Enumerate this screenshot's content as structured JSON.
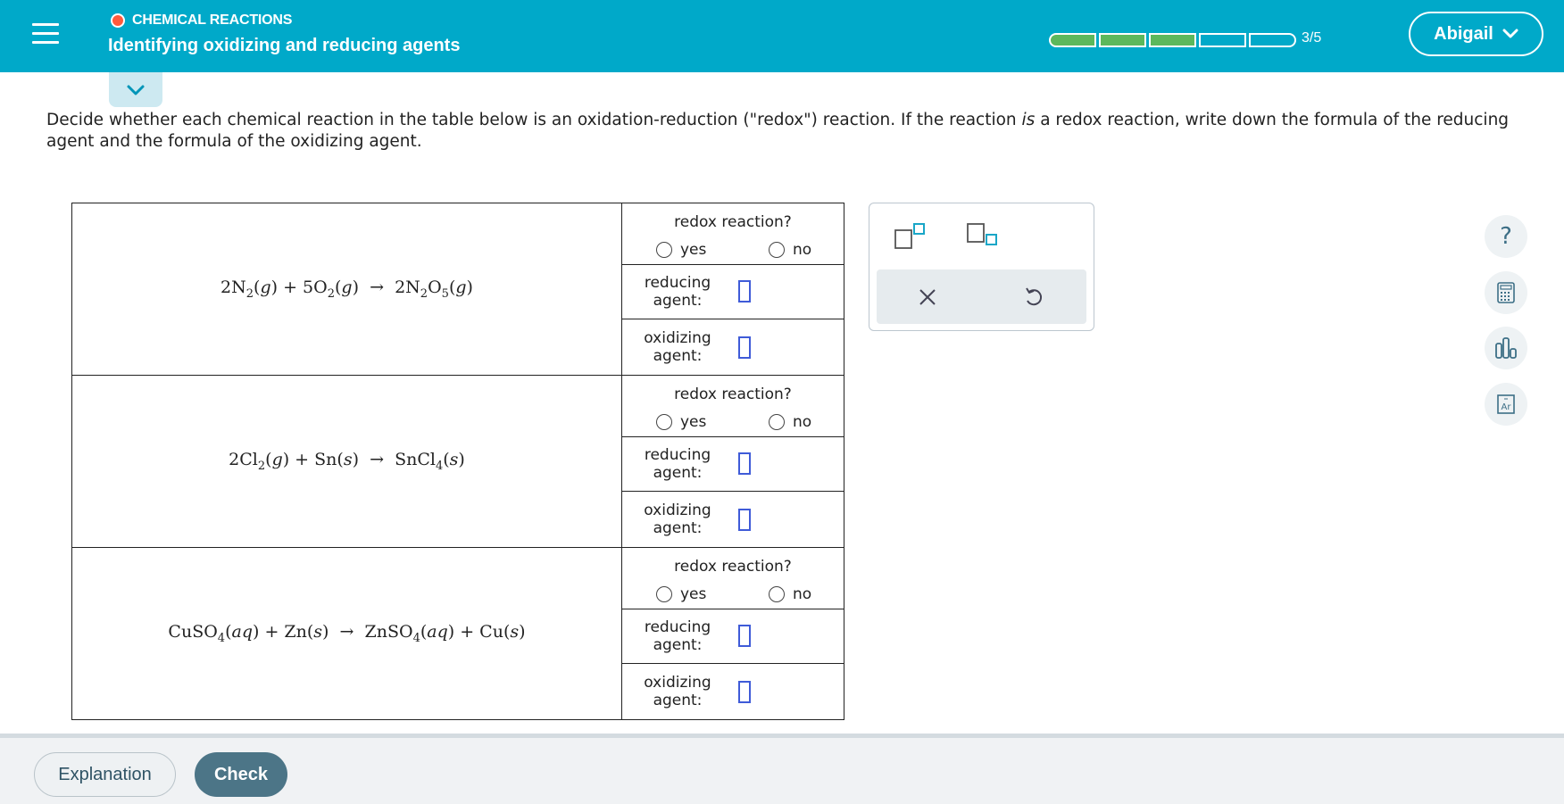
{
  "header": {
    "topic": "CHEMICAL REACTIONS",
    "title": "Identifying oxidizing and reducing agents",
    "progress_text": "3/5",
    "progress": {
      "completed": 3,
      "total": 5
    },
    "user_name": "Abigail"
  },
  "instructions": {
    "part1": "Decide whether each chemical reaction in the table below is an oxidation-reduction (\"redox\") reaction. If the reaction ",
    "emphasis": "is",
    "part2": " a redox reaction, write down the formula of the reducing agent and the formula of the oxidizing agent."
  },
  "table": {
    "redox_question": "redox reaction?",
    "yes_label": "yes",
    "no_label": "no",
    "reducing_label_1": "reducing",
    "reducing_label_2": "agent:",
    "oxidizing_label_1": "oxidizing",
    "oxidizing_label_2": "agent:",
    "reactions": [
      {
        "equation": "2N2(g) + 5O2(g) → 2N2O5(g)"
      },
      {
        "equation": "2Cl2(g) + Sn(s) → SnCl4(s)"
      },
      {
        "equation": "CuSO4(aq) + Zn(s) → ZnSO4(aq) + Cu(s)"
      }
    ]
  },
  "footer": {
    "explanation_label": "Explanation",
    "check_label": "Check"
  },
  "colors": {
    "header_bg": "#00a9c9",
    "progress_fill": "#5cb85c",
    "input_border": "#3f5bd8",
    "check_bg": "#4c7587"
  }
}
